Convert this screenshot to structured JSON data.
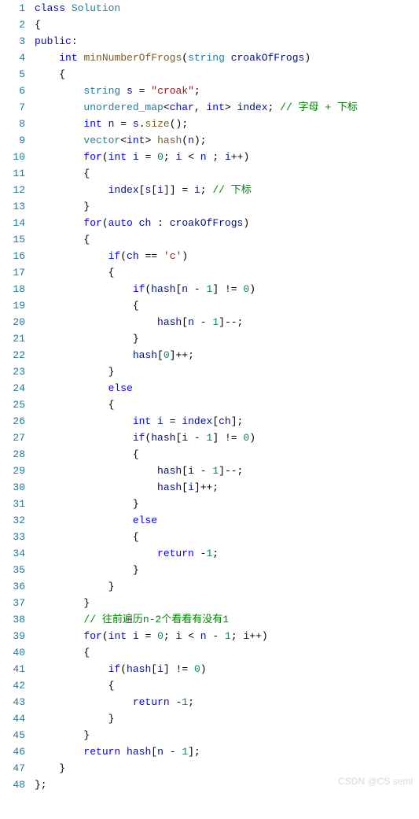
{
  "watermark": "CSDN @CS semi",
  "lines": [
    {
      "n": "1",
      "seg": [
        {
          "c": "kw",
          "t": "class"
        },
        {
          "t": " "
        },
        {
          "c": "cls",
          "t": "Solution"
        }
      ]
    },
    {
      "n": "2",
      "seg": [
        {
          "c": "brace",
          "t": "{"
        }
      ]
    },
    {
      "n": "3",
      "seg": [
        {
          "c": "kw",
          "t": "public"
        },
        {
          "c": "op",
          "t": ":"
        }
      ]
    },
    {
      "n": "4",
      "seg": [
        {
          "t": "    "
        },
        {
          "c": "kw",
          "t": "int"
        },
        {
          "t": " "
        },
        {
          "c": "fn",
          "t": "minNumberOfFrogs"
        },
        {
          "c": "brace",
          "t": "("
        },
        {
          "c": "cls",
          "t": "string"
        },
        {
          "t": " "
        },
        {
          "c": "var",
          "t": "croakOfFrogs"
        },
        {
          "c": "brace",
          "t": ")"
        }
      ]
    },
    {
      "n": "5",
      "seg": [
        {
          "t": "    "
        },
        {
          "c": "brace",
          "t": "{"
        }
      ]
    },
    {
      "n": "6",
      "seg": [
        {
          "t": "        "
        },
        {
          "c": "cls",
          "t": "string"
        },
        {
          "t": " "
        },
        {
          "c": "var",
          "t": "s"
        },
        {
          "t": " "
        },
        {
          "c": "op",
          "t": "="
        },
        {
          "t": " "
        },
        {
          "c": "str",
          "t": "\"croak\""
        },
        {
          "c": "op",
          "t": ";"
        }
      ]
    },
    {
      "n": "7",
      "seg": [
        {
          "t": "        "
        },
        {
          "c": "cls",
          "t": "unordered_map"
        },
        {
          "c": "op",
          "t": "<"
        },
        {
          "c": "kw",
          "t": "char"
        },
        {
          "c": "op",
          "t": ", "
        },
        {
          "c": "kw",
          "t": "int"
        },
        {
          "c": "op",
          "t": ">"
        },
        {
          "t": " "
        },
        {
          "c": "var",
          "t": "index"
        },
        {
          "c": "op",
          "t": ";"
        },
        {
          "t": " "
        },
        {
          "c": "cmt",
          "t": "// 字母 + 下标"
        }
      ]
    },
    {
      "n": "8",
      "seg": [
        {
          "t": "        "
        },
        {
          "c": "kw",
          "t": "int"
        },
        {
          "t": " "
        },
        {
          "c": "var",
          "t": "n"
        },
        {
          "t": " "
        },
        {
          "c": "op",
          "t": "="
        },
        {
          "t": " "
        },
        {
          "c": "var",
          "t": "s"
        },
        {
          "c": "op",
          "t": "."
        },
        {
          "c": "fn",
          "t": "size"
        },
        {
          "c": "brace",
          "t": "()"
        },
        {
          "c": "op",
          "t": ";"
        }
      ]
    },
    {
      "n": "9",
      "seg": [
        {
          "t": "        "
        },
        {
          "c": "cls",
          "t": "vector"
        },
        {
          "c": "op",
          "t": "<"
        },
        {
          "c": "kw",
          "t": "int"
        },
        {
          "c": "op",
          "t": ">"
        },
        {
          "t": " "
        },
        {
          "c": "fn",
          "t": "hash"
        },
        {
          "c": "brace",
          "t": "("
        },
        {
          "c": "var",
          "t": "n"
        },
        {
          "c": "brace",
          "t": ")"
        },
        {
          "c": "op",
          "t": ";"
        }
      ]
    },
    {
      "n": "10",
      "seg": [
        {
          "t": "        "
        },
        {
          "c": "kw",
          "t": "for"
        },
        {
          "c": "brace",
          "t": "("
        },
        {
          "c": "kw",
          "t": "int"
        },
        {
          "t": " "
        },
        {
          "c": "var",
          "t": "i"
        },
        {
          "t": " "
        },
        {
          "c": "op",
          "t": "="
        },
        {
          "t": " "
        },
        {
          "c": "num",
          "t": "0"
        },
        {
          "c": "op",
          "t": ";"
        },
        {
          "t": " "
        },
        {
          "c": "var",
          "t": "i"
        },
        {
          "t": " "
        },
        {
          "c": "op",
          "t": "<"
        },
        {
          "t": " "
        },
        {
          "c": "var",
          "t": "n"
        },
        {
          "t": " "
        },
        {
          "c": "op",
          "t": ";"
        },
        {
          "t": " "
        },
        {
          "c": "var",
          "t": "i"
        },
        {
          "c": "op",
          "t": "++"
        },
        {
          "c": "brace",
          "t": ")"
        }
      ]
    },
    {
      "n": "11",
      "seg": [
        {
          "t": "        "
        },
        {
          "c": "brace",
          "t": "{"
        }
      ]
    },
    {
      "n": "12",
      "seg": [
        {
          "t": "            "
        },
        {
          "c": "var",
          "t": "index"
        },
        {
          "c": "brace",
          "t": "["
        },
        {
          "c": "var",
          "t": "s"
        },
        {
          "c": "brace",
          "t": "["
        },
        {
          "c": "var",
          "t": "i"
        },
        {
          "c": "brace",
          "t": "]]"
        },
        {
          "t": " "
        },
        {
          "c": "op",
          "t": "="
        },
        {
          "t": " "
        },
        {
          "c": "var",
          "t": "i"
        },
        {
          "c": "op",
          "t": ";"
        },
        {
          "t": " "
        },
        {
          "c": "cmt",
          "t": "// 下标"
        }
      ]
    },
    {
      "n": "13",
      "seg": [
        {
          "t": "        "
        },
        {
          "c": "brace",
          "t": "}"
        }
      ]
    },
    {
      "n": "14",
      "seg": [
        {
          "t": "        "
        },
        {
          "c": "kw",
          "t": "for"
        },
        {
          "c": "brace",
          "t": "("
        },
        {
          "c": "kw",
          "t": "auto"
        },
        {
          "t": " "
        },
        {
          "c": "var",
          "t": "ch"
        },
        {
          "t": " "
        },
        {
          "c": "op",
          "t": ":"
        },
        {
          "t": " "
        },
        {
          "c": "var",
          "t": "croakOfFrogs"
        },
        {
          "c": "brace",
          "t": ")"
        }
      ]
    },
    {
      "n": "15",
      "seg": [
        {
          "t": "        "
        },
        {
          "c": "brace",
          "t": "{"
        }
      ]
    },
    {
      "n": "16",
      "seg": [
        {
          "t": "            "
        },
        {
          "c": "kw",
          "t": "if"
        },
        {
          "c": "brace",
          "t": "("
        },
        {
          "c": "var",
          "t": "ch"
        },
        {
          "t": " "
        },
        {
          "c": "op",
          "t": "=="
        },
        {
          "t": " "
        },
        {
          "c": "str",
          "t": "'c'"
        },
        {
          "c": "brace",
          "t": ")"
        }
      ]
    },
    {
      "n": "17",
      "seg": [
        {
          "t": "            "
        },
        {
          "c": "brace",
          "t": "{"
        }
      ]
    },
    {
      "n": "18",
      "seg": [
        {
          "t": "                "
        },
        {
          "c": "kw",
          "t": "if"
        },
        {
          "c": "brace",
          "t": "("
        },
        {
          "c": "var",
          "t": "hash"
        },
        {
          "c": "brace",
          "t": "["
        },
        {
          "c": "var",
          "t": "n"
        },
        {
          "t": " "
        },
        {
          "c": "op",
          "t": "-"
        },
        {
          "t": " "
        },
        {
          "c": "num",
          "t": "1"
        },
        {
          "c": "brace",
          "t": "]"
        },
        {
          "t": " "
        },
        {
          "c": "op",
          "t": "!="
        },
        {
          "t": " "
        },
        {
          "c": "num",
          "t": "0"
        },
        {
          "c": "brace",
          "t": ")"
        }
      ]
    },
    {
      "n": "19",
      "seg": [
        {
          "t": "                "
        },
        {
          "c": "brace",
          "t": "{"
        }
      ]
    },
    {
      "n": "20",
      "seg": [
        {
          "t": "                    "
        },
        {
          "c": "var",
          "t": "hash"
        },
        {
          "c": "brace",
          "t": "["
        },
        {
          "c": "var",
          "t": "n"
        },
        {
          "t": " "
        },
        {
          "c": "op",
          "t": "-"
        },
        {
          "t": " "
        },
        {
          "c": "num",
          "t": "1"
        },
        {
          "c": "brace",
          "t": "]"
        },
        {
          "c": "op",
          "t": "--;"
        }
      ]
    },
    {
      "n": "21",
      "seg": [
        {
          "t": "                "
        },
        {
          "c": "brace",
          "t": "}"
        }
      ]
    },
    {
      "n": "22",
      "seg": [
        {
          "t": "                "
        },
        {
          "c": "var",
          "t": "hash"
        },
        {
          "c": "brace",
          "t": "["
        },
        {
          "c": "num",
          "t": "0"
        },
        {
          "c": "brace",
          "t": "]"
        },
        {
          "c": "op",
          "t": "++;"
        }
      ]
    },
    {
      "n": "23",
      "seg": [
        {
          "t": "            "
        },
        {
          "c": "brace",
          "t": "}"
        }
      ]
    },
    {
      "n": "24",
      "seg": [
        {
          "t": "            "
        },
        {
          "c": "kw",
          "t": "else"
        }
      ]
    },
    {
      "n": "25",
      "seg": [
        {
          "t": "            "
        },
        {
          "c": "brace",
          "t": "{"
        }
      ]
    },
    {
      "n": "26",
      "seg": [
        {
          "t": "                "
        },
        {
          "c": "kw",
          "t": "int"
        },
        {
          "t": " "
        },
        {
          "c": "var",
          "t": "i"
        },
        {
          "t": " "
        },
        {
          "c": "op",
          "t": "="
        },
        {
          "t": " "
        },
        {
          "c": "var",
          "t": "index"
        },
        {
          "c": "brace",
          "t": "["
        },
        {
          "c": "var",
          "t": "ch"
        },
        {
          "c": "brace",
          "t": "]"
        },
        {
          "c": "op",
          "t": ";"
        }
      ]
    },
    {
      "n": "27",
      "seg": [
        {
          "t": "                "
        },
        {
          "c": "kw",
          "t": "if"
        },
        {
          "c": "brace",
          "t": "("
        },
        {
          "c": "var",
          "t": "hash"
        },
        {
          "c": "brace",
          "t": "["
        },
        {
          "c": "var",
          "t": "i"
        },
        {
          "t": " "
        },
        {
          "c": "op",
          "t": "-"
        },
        {
          "t": " "
        },
        {
          "c": "num",
          "t": "1"
        },
        {
          "c": "brace",
          "t": "]"
        },
        {
          "t": " "
        },
        {
          "c": "op",
          "t": "!="
        },
        {
          "t": " "
        },
        {
          "c": "num",
          "t": "0"
        },
        {
          "c": "brace",
          "t": ")"
        }
      ]
    },
    {
      "n": "28",
      "seg": [
        {
          "t": "                "
        },
        {
          "c": "brace",
          "t": "{"
        }
      ]
    },
    {
      "n": "29",
      "seg": [
        {
          "t": "                    "
        },
        {
          "c": "var",
          "t": "hash"
        },
        {
          "c": "brace",
          "t": "["
        },
        {
          "c": "var",
          "t": "i"
        },
        {
          "t": " "
        },
        {
          "c": "op",
          "t": "-"
        },
        {
          "t": " "
        },
        {
          "c": "num",
          "t": "1"
        },
        {
          "c": "brace",
          "t": "]"
        },
        {
          "c": "op",
          "t": "--;"
        }
      ]
    },
    {
      "n": "30",
      "seg": [
        {
          "t": "                    "
        },
        {
          "c": "var",
          "t": "hash"
        },
        {
          "c": "brace",
          "t": "["
        },
        {
          "c": "var",
          "t": "i"
        },
        {
          "c": "brace",
          "t": "]"
        },
        {
          "c": "op",
          "t": "++;"
        }
      ]
    },
    {
      "n": "31",
      "seg": [
        {
          "t": "                "
        },
        {
          "c": "brace",
          "t": "}"
        }
      ]
    },
    {
      "n": "32",
      "seg": [
        {
          "t": "                "
        },
        {
          "c": "kw",
          "t": "else"
        }
      ]
    },
    {
      "n": "33",
      "seg": [
        {
          "t": "                "
        },
        {
          "c": "brace",
          "t": "{"
        }
      ]
    },
    {
      "n": "34",
      "seg": [
        {
          "t": "                    "
        },
        {
          "c": "kw",
          "t": "return"
        },
        {
          "t": " "
        },
        {
          "c": "op",
          "t": "-"
        },
        {
          "c": "num",
          "t": "1"
        },
        {
          "c": "op",
          "t": ";"
        }
      ]
    },
    {
      "n": "35",
      "seg": [
        {
          "t": "                "
        },
        {
          "c": "brace",
          "t": "}"
        }
      ]
    },
    {
      "n": "36",
      "seg": [
        {
          "t": "            "
        },
        {
          "c": "brace",
          "t": "}"
        }
      ]
    },
    {
      "n": "37",
      "seg": [
        {
          "t": "        "
        },
        {
          "c": "brace",
          "t": "}"
        }
      ]
    },
    {
      "n": "38",
      "seg": [
        {
          "t": "        "
        },
        {
          "c": "cmt",
          "t": "// 往前遍历n-2个看看有没有1"
        }
      ]
    },
    {
      "n": "39",
      "seg": [
        {
          "t": "        "
        },
        {
          "c": "kw",
          "t": "for"
        },
        {
          "c": "brace",
          "t": "("
        },
        {
          "c": "kw",
          "t": "int"
        },
        {
          "t": " "
        },
        {
          "c": "var",
          "t": "i"
        },
        {
          "t": " "
        },
        {
          "c": "op",
          "t": "="
        },
        {
          "t": " "
        },
        {
          "c": "num",
          "t": "0"
        },
        {
          "c": "op",
          "t": ";"
        },
        {
          "t": " "
        },
        {
          "c": "var",
          "t": "i"
        },
        {
          "t": " "
        },
        {
          "c": "op",
          "t": "<"
        },
        {
          "t": " "
        },
        {
          "c": "var",
          "t": "n"
        },
        {
          "t": " "
        },
        {
          "c": "op",
          "t": "-"
        },
        {
          "t": " "
        },
        {
          "c": "num",
          "t": "1"
        },
        {
          "c": "op",
          "t": ";"
        },
        {
          "t": " "
        },
        {
          "c": "var",
          "t": "i"
        },
        {
          "c": "op",
          "t": "++"
        },
        {
          "c": "brace",
          "t": ")"
        }
      ]
    },
    {
      "n": "40",
      "seg": [
        {
          "t": "        "
        },
        {
          "c": "brace",
          "t": "{"
        }
      ]
    },
    {
      "n": "41",
      "seg": [
        {
          "t": "            "
        },
        {
          "c": "kw",
          "t": "if"
        },
        {
          "c": "brace",
          "t": "("
        },
        {
          "c": "var",
          "t": "hash"
        },
        {
          "c": "brace",
          "t": "["
        },
        {
          "c": "var",
          "t": "i"
        },
        {
          "c": "brace",
          "t": "]"
        },
        {
          "t": " "
        },
        {
          "c": "op",
          "t": "!="
        },
        {
          "t": " "
        },
        {
          "c": "num",
          "t": "0"
        },
        {
          "c": "brace",
          "t": ")"
        }
      ]
    },
    {
      "n": "42",
      "seg": [
        {
          "t": "            "
        },
        {
          "c": "brace",
          "t": "{"
        }
      ]
    },
    {
      "n": "43",
      "seg": [
        {
          "t": "                "
        },
        {
          "c": "kw",
          "t": "return"
        },
        {
          "t": " "
        },
        {
          "c": "op",
          "t": "-"
        },
        {
          "c": "num",
          "t": "1"
        },
        {
          "c": "op",
          "t": ";"
        }
      ]
    },
    {
      "n": "44",
      "seg": [
        {
          "t": "            "
        },
        {
          "c": "brace",
          "t": "}"
        }
      ]
    },
    {
      "n": "45",
      "seg": [
        {
          "t": "        "
        },
        {
          "c": "brace",
          "t": "}"
        }
      ]
    },
    {
      "n": "46",
      "seg": [
        {
          "t": "        "
        },
        {
          "c": "kw",
          "t": "return"
        },
        {
          "t": " "
        },
        {
          "c": "var",
          "t": "hash"
        },
        {
          "c": "brace",
          "t": "["
        },
        {
          "c": "var",
          "t": "n"
        },
        {
          "t": " "
        },
        {
          "c": "op",
          "t": "-"
        },
        {
          "t": " "
        },
        {
          "c": "num",
          "t": "1"
        },
        {
          "c": "brace",
          "t": "]"
        },
        {
          "c": "op",
          "t": ";"
        }
      ]
    },
    {
      "n": "47",
      "seg": [
        {
          "t": "    "
        },
        {
          "c": "brace",
          "t": "}"
        }
      ]
    },
    {
      "n": "48",
      "seg": [
        {
          "c": "brace",
          "t": "};"
        }
      ]
    }
  ]
}
